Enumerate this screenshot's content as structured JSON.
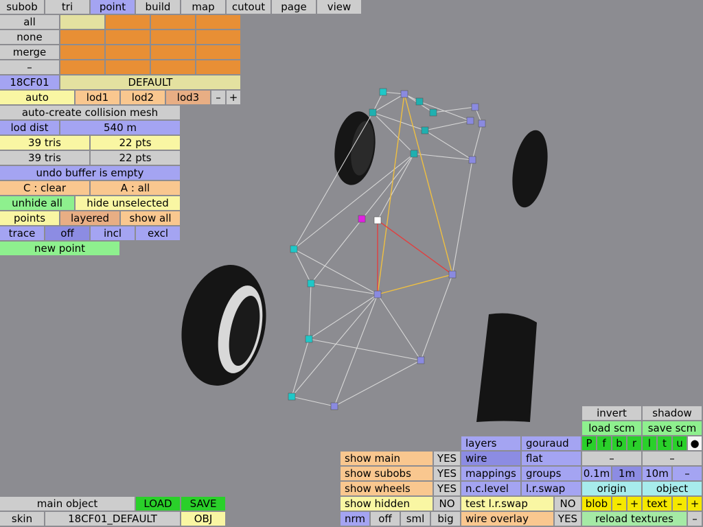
{
  "top_menu": [
    "subob",
    "tri",
    "point",
    "build",
    "map",
    "cutout",
    "page",
    "view"
  ],
  "select": {
    "all": "all",
    "none": "none",
    "merge": "merge",
    "dash": "–"
  },
  "object": {
    "name": "18CF01",
    "skin": "DEFAULT"
  },
  "lod": {
    "auto": "auto",
    "lod1": "lod1",
    "lod2": "lod2",
    "lod3": "lod3",
    "minus": "–",
    "plus": "+"
  },
  "collision": "auto-create collision mesh",
  "lod_dist": {
    "label": "lod dist",
    "value": "540 m"
  },
  "stats": {
    "tris1": "39 tris",
    "pts1": "22 pts",
    "tris2": "39 tris",
    "pts2": "22 pts"
  },
  "undo": "undo buffer is empty",
  "clear": {
    "c": "C : clear",
    "a": "A : all"
  },
  "hide": {
    "unhide": "unhide all",
    "hide_unsel": "hide unselected"
  },
  "points_row": {
    "points": "points",
    "layered": "layered",
    "show_all": "show all"
  },
  "trace_row": {
    "trace": "trace",
    "off": "off",
    "incl": "incl",
    "excl": "excl"
  },
  "new_point": "new point",
  "bottom_left": {
    "main_object": "main object",
    "load": "LOAD",
    "save": "SAVE",
    "skin": "skin",
    "skin_name": "18CF01_DEFAULT",
    "obj": "OBJ"
  },
  "show_panel": {
    "main": "show main",
    "main_v": "YES",
    "subobs": "show subobs",
    "subobs_v": "YES",
    "wheels": "show wheels",
    "wheels_v": "YES",
    "hidden": "show hidden",
    "hidden_v": "NO",
    "nrm": "nrm",
    "off": "off",
    "sml": "sml",
    "big": "big"
  },
  "render_panel": {
    "layers": "layers",
    "gouraud": "gouraud",
    "wire": "wire",
    "flat": "flat",
    "mappings": "mappings",
    "groups": "groups",
    "nclevel": "n.c.level",
    "lrswap": "l.r.swap",
    "test_lr": "test l.r.swap",
    "test_lr_v": "NO",
    "wire_overlay": "wire overlay",
    "wire_overlay_v": "YES"
  },
  "right_panel": {
    "invert": "invert",
    "shadow": "shadow",
    "load_scm": "load scm",
    "save_scm": "save scm",
    "letters": [
      "P",
      "f",
      "b",
      "r",
      "l",
      "t",
      "u"
    ],
    "dot": "●",
    "dash1": "–",
    "dash2": "–",
    "g01": "0.1m",
    "g1": "1m",
    "g10": "10m",
    "gminus": "–",
    "origin": "origin",
    "object": "object",
    "blob": "blob",
    "blob_minus": "–",
    "blob_plus": "+",
    "text": "text",
    "text_minus": "–",
    "text_plus": "+",
    "reload": "reload textures",
    "reload_minus": "–"
  },
  "colors": {
    "background": "#8c8c91",
    "selected_tab": "#a4a4f2",
    "point_cyan": "#1fc8c8",
    "point_purple": "#8a8ae0",
    "point_magenta": "#e020e0",
    "edge": "#d8d8d8",
    "edge_yellow": "#f0c040",
    "edge_red": "#e04040"
  }
}
